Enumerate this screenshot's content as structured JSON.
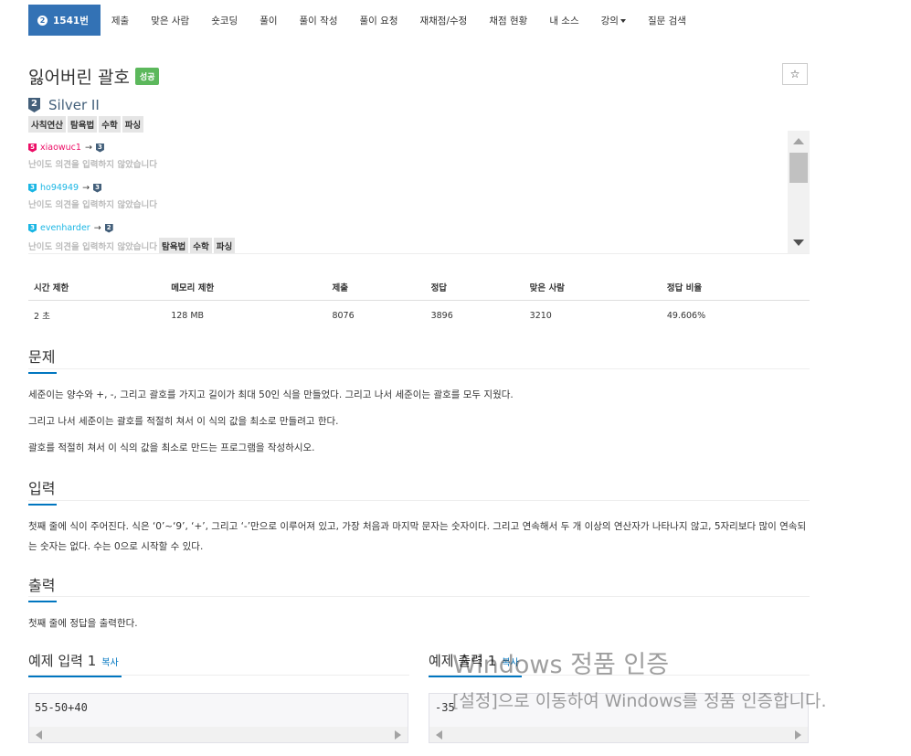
{
  "nav": {
    "active_icon": "2",
    "active_label": "1541번",
    "items": [
      "제출",
      "맞은 사람",
      "숏코딩",
      "풀이",
      "풀이 작성",
      "풀이 요청",
      "재채점/수정",
      "채점 현황",
      "내 소스",
      "강의",
      "질문 검색"
    ]
  },
  "problem": {
    "title": "잃어버린 괄호",
    "status_badge": "성공",
    "star": "☆",
    "tier_num": "2",
    "tier": "Silver II",
    "tags": [
      "사칙연산",
      "탐욕법",
      "수학",
      "파싱"
    ]
  },
  "opinions": [
    {
      "from_tier": "5",
      "from_color": "#ec0e66",
      "user": "xiaowuc1",
      "user_color": "#ec0e66",
      "to_tier": "3",
      "to_color": "#435f7a",
      "arrow": "→",
      "text": "난이도 의견을 입력하지 않았습니다",
      "tags": []
    },
    {
      "from_tier": "3",
      "from_color": "#1ab6e4",
      "user": "ho94949",
      "user_color": "#1ab6e4",
      "to_tier": "3",
      "to_color": "#435f7a",
      "arrow": "→",
      "text": "난이도 의견을 입력하지 않았습니다",
      "tags": []
    },
    {
      "from_tier": "3",
      "from_color": "#1ab6e4",
      "user": "evenharder",
      "user_color": "#1ab6e4",
      "to_tier": "2",
      "to_color": "#435f7a",
      "arrow": "→",
      "text": "난이도 의견을 입력하지 않았습니다",
      "tags": [
        "탐욕법",
        "수학",
        "파싱"
      ]
    }
  ],
  "stats": {
    "headers": [
      "시간 제한",
      "메모리 제한",
      "제출",
      "정답",
      "맞은 사람",
      "정답 비율"
    ],
    "values": [
      "2 초",
      "128 MB",
      "8076",
      "3896",
      "3210",
      "49.606%"
    ]
  },
  "sections": {
    "problem_title": "문제",
    "problem_lines": [
      "세준이는 양수와 +, -, 그리고 괄호를 가지고 길이가 최대 50인 식을 만들었다. 그리고 나서 세준이는 괄호를 모두 지웠다.",
      "그리고 나서 세준이는 괄호를 적절히 쳐서 이 식의 값을 최소로 만들려고 한다.",
      "괄호를 적절히 쳐서 이 식의 값을 최소로 만드는 프로그램을 작성하시오."
    ],
    "input_title": "입력",
    "input_text": "첫째 줄에 식이 주어진다. 식은 ‘0’~‘9’, ‘+’, 그리고 ‘-’만으로 이루어져 있고, 가장 처음과 마지막 문자는 숫자이다. 그리고 연속해서 두 개 이상의 연산자가 나타나지 않고, 5자리보다 많이 연속되는 숫자는 없다. 수는 0으로 시작할 수 있다.",
    "output_title": "출력",
    "output_text": "첫째 줄에 정답을 출력한다."
  },
  "samples": {
    "input_title": "예제 입력 1",
    "input_copy": "복사",
    "input_value": "55-50+40",
    "output_title": "예제 출력 1",
    "output_copy": "복사",
    "output_value": "-35"
  },
  "watermark": {
    "line1": "Windows 정품 인증",
    "line2": "[설정]으로 이동하여 Windows를 정품 인증합니다."
  },
  "colors": {
    "accent": "#3372b5",
    "link": "#0076c0",
    "success": "#5cb85c",
    "silver": "#435f7a"
  }
}
